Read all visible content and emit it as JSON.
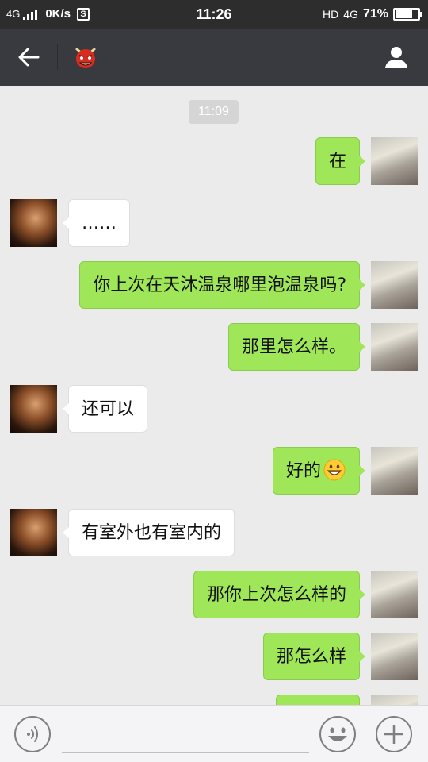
{
  "status_bar": {
    "network": "4G",
    "speed": "0K/s",
    "s_badge": "S",
    "time": "11:26",
    "hd": "HD",
    "network_right": "4G",
    "battery": "71%",
    "battery_level": 0.71
  },
  "header": {
    "back_icon": "arrow-left-icon",
    "contact_icon": "red-demon-mask-icon",
    "profile_icon": "person-icon"
  },
  "chat": {
    "timestamp": "11:09",
    "messages": [
      {
        "side": "me",
        "text": "在"
      },
      {
        "side": "them",
        "text": "……"
      },
      {
        "side": "me",
        "text": "你上次在天沐温泉哪里泡温泉吗?"
      },
      {
        "side": "me",
        "text": "那里怎么样。"
      },
      {
        "side": "them",
        "text": "还可以"
      },
      {
        "side": "me",
        "text": "好的",
        "emoji": "grinning-face"
      },
      {
        "side": "them",
        "text": "有室外也有室内的"
      },
      {
        "side": "me",
        "text": "那你上次怎么样的"
      },
      {
        "side": "me",
        "text": "那怎么样"
      }
    ]
  },
  "input_bar": {
    "voice_icon": "voice-icon",
    "input_value": "",
    "emoji_icon": "smiley-icon",
    "plus_icon": "plus-icon"
  },
  "colors": {
    "header_bg": "#393a3f",
    "status_bg": "#2d2d2d",
    "chat_bg": "#ebebeb",
    "bubble_me": "#9fe658",
    "bubble_them": "#ffffff"
  }
}
